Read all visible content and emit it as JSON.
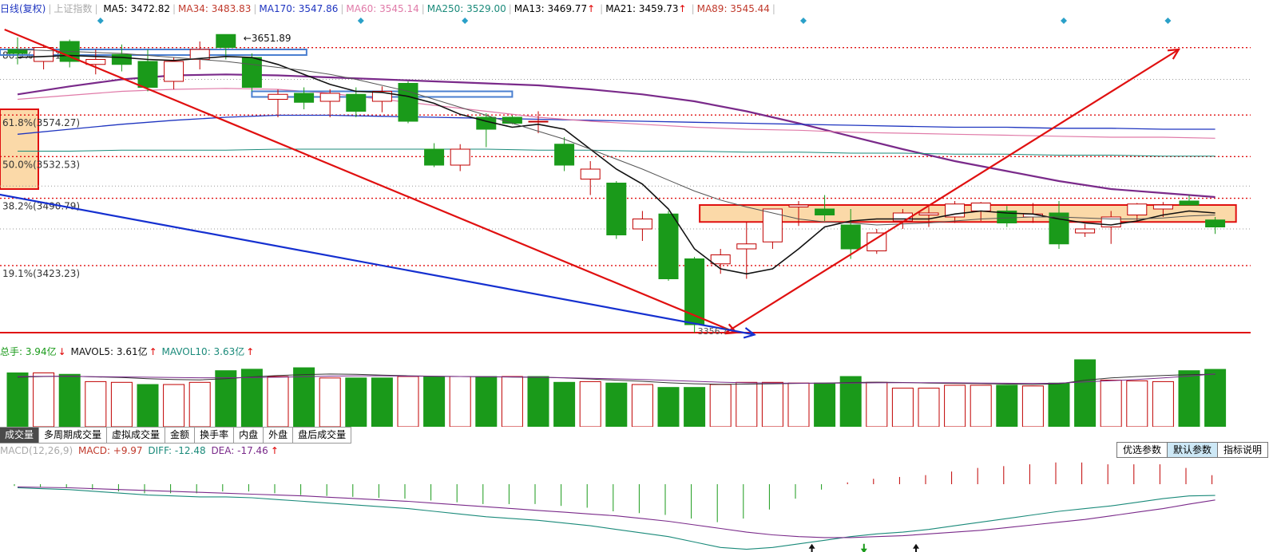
{
  "main_legend": {
    "title": "日线(复权)",
    "index_name": "上证指数",
    "ma_items": [
      {
        "label": "MA5: 3472.82",
        "color": "#000000",
        "arrow": false
      },
      {
        "label": "MA34: 3483.83",
        "color": "#c0392b",
        "arrow": false
      },
      {
        "label": "MA170: 3547.86",
        "color": "#1f35c0",
        "arrow": false
      },
      {
        "label": "MA60: 3545.14",
        "color": "#e07aa8",
        "arrow": false
      },
      {
        "label": "MA250: 3529.00",
        "color": "#1a8a7a",
        "arrow": false
      },
      {
        "label": "MA13: 3469.77",
        "color": "#000000",
        "arrow": true
      },
      {
        "label": "MA21: 3459.73",
        "color": "#000000",
        "arrow": true
      },
      {
        "label": "MA89: 3545.44",
        "color": "#c0392b",
        "arrow": false
      }
    ]
  },
  "fib_labels": [
    {
      "label": "80.9%(3641.82)",
      "price": 3641.82
    },
    {
      "label": "61.8%(3574.27)",
      "price": 3574.27
    },
    {
      "label": "50.0%(3532.53)",
      "price": 3532.53
    },
    {
      "label": "38.2%(3490.79)",
      "price": 3490.79
    },
    {
      "label": "19.1%(3423.23)",
      "price": 3423.23
    }
  ],
  "annotations": {
    "high_label": "3651.89",
    "low_label": "3356.?"
  },
  "volume_legend": {
    "total_label": "总手: 3.94亿",
    "mavol5_label": "MAVOL5: 3.61亿",
    "mavol10_label": "MAVOL10: 3.63亿"
  },
  "volume_tabs": [
    "成交量",
    "多周期成交量",
    "虚拟成交量",
    "金额",
    "换手率",
    "内盘",
    "外盘",
    "盘后成交量"
  ],
  "macd_legend": {
    "name_label": "MACD(12,26,9)",
    "macd_label": "MACD: +9.97",
    "diff_label": "DIFF: -12.48",
    "dea_label": "DEA: -17.46"
  },
  "macd_buttons": [
    "优选参数",
    "默认参数",
    "指标说明"
  ],
  "colors": {
    "up": "#c00000",
    "down": "#1a9a1a",
    "trend_red": "#e01010",
    "trend_blue": "#1530d0",
    "ma_purple": "#7a2a8a",
    "fib_dot": "#e01010",
    "box_fill": "#fbd9a8"
  },
  "chart_data": [
    {
      "type": "candlestick",
      "title": "上证指数 日线(复权)",
      "ylim": [
        3348,
        3672
      ],
      "horizontal_levels": [
        3641.82,
        3574.27,
        3532.53,
        3490.79,
        3423.23,
        3356.0
      ],
      "candles": [
        {
          "o": 3640,
          "h": 3652,
          "l": 3625,
          "c": 3636
        },
        {
          "o": 3628,
          "h": 3645,
          "l": 3620,
          "c": 3642
        },
        {
          "o": 3648,
          "h": 3650,
          "l": 3622,
          "c": 3628
        },
        {
          "o": 3625,
          "h": 3640,
          "l": 3615,
          "c": 3630
        },
        {
          "o": 3635,
          "h": 3645,
          "l": 3618,
          "c": 3625
        },
        {
          "o": 3628,
          "h": 3640,
          "l": 3598,
          "c": 3602
        },
        {
          "o": 3608,
          "h": 3632,
          "l": 3600,
          "c": 3628
        },
        {
          "o": 3630,
          "h": 3648,
          "l": 3620,
          "c": 3640
        },
        {
          "o": 3655,
          "h": 3652,
          "l": 3630,
          "c": 3642
        },
        {
          "o": 3632,
          "h": 3636,
          "l": 3598,
          "c": 3602
        },
        {
          "o": 3590,
          "h": 3600,
          "l": 3572,
          "c": 3595
        },
        {
          "o": 3596,
          "h": 3602,
          "l": 3580,
          "c": 3587
        },
        {
          "o": 3588,
          "h": 3600,
          "l": 3572,
          "c": 3596
        },
        {
          "o": 3595,
          "h": 3602,
          "l": 3572,
          "c": 3578
        },
        {
          "o": 3588,
          "h": 3603,
          "l": 3577,
          "c": 3598
        },
        {
          "o": 3606,
          "h": 3608,
          "l": 3566,
          "c": 3568
        },
        {
          "o": 3540,
          "h": 3546,
          "l": 3522,
          "c": 3524
        },
        {
          "o": 3524,
          "h": 3545,
          "l": 3518,
          "c": 3540
        },
        {
          "o": 3572,
          "h": 3576,
          "l": 3542,
          "c": 3560
        },
        {
          "o": 3572,
          "h": 3574,
          "l": 3565,
          "c": 3566
        },
        {
          "o": 3568,
          "h": 3578,
          "l": 3556,
          "c": 3568
        },
        {
          "o": 3545,
          "h": 3552,
          "l": 3518,
          "c": 3524
        },
        {
          "o": 3510,
          "h": 3528,
          "l": 3494,
          "c": 3520
        },
        {
          "o": 3506,
          "h": 3508,
          "l": 3450,
          "c": 3454
        },
        {
          "o": 3460,
          "h": 3478,
          "l": 3448,
          "c": 3470
        },
        {
          "o": 3475,
          "h": 3478,
          "l": 3408,
          "c": 3410
        },
        {
          "o": 3430,
          "h": 3432,
          "l": 3356,
          "c": 3364
        },
        {
          "o": 3425,
          "h": 3440,
          "l": 3415,
          "c": 3434
        },
        {
          "o": 3440,
          "h": 3467,
          "l": 3410,
          "c": 3445
        },
        {
          "o": 3447,
          "h": 3477,
          "l": 3440,
          "c": 3480
        },
        {
          "o": 3482,
          "h": 3488,
          "l": 3463,
          "c": 3484
        },
        {
          "o": 3480,
          "h": 3494,
          "l": 3468,
          "c": 3474
        },
        {
          "o": 3464,
          "h": 3480,
          "l": 3430,
          "c": 3440
        },
        {
          "o": 3438,
          "h": 3460,
          "l": 3435,
          "c": 3456
        },
        {
          "o": 3468,
          "h": 3480,
          "l": 3460,
          "c": 3476
        },
        {
          "o": 3474,
          "h": 3482,
          "l": 3462,
          "c": 3476
        },
        {
          "o": 3472,
          "h": 3488,
          "l": 3466,
          "c": 3485
        },
        {
          "o": 3478,
          "h": 3487,
          "l": 3468,
          "c": 3486
        },
        {
          "o": 3478,
          "h": 3483,
          "l": 3462,
          "c": 3466
        },
        {
          "o": 3472,
          "h": 3486,
          "l": 3466,
          "c": 3475
        },
        {
          "o": 3476,
          "h": 3488,
          "l": 3440,
          "c": 3445
        },
        {
          "o": 3456,
          "h": 3465,
          "l": 3452,
          "c": 3460
        },
        {
          "o": 3462,
          "h": 3478,
          "l": 3445,
          "c": 3472
        },
        {
          "o": 3474,
          "h": 3486,
          "l": 3468,
          "c": 3485
        },
        {
          "o": 3480,
          "h": 3487,
          "l": 3472,
          "c": 3484
        },
        {
          "o": 3488,
          "h": 3494,
          "l": 3484,
          "c": 3484
        },
        {
          "o": 3469,
          "h": 3472,
          "l": 3455,
          "c": 3462
        }
      ],
      "ma_lines": [
        {
          "name": "MA5",
          "color": "#111111",
          "values": [
            3632,
            3633,
            3634,
            3633,
            3632,
            3630,
            3629,
            3631,
            3633,
            3632,
            3625,
            3615,
            3605,
            3598,
            3597,
            3593,
            3586,
            3575,
            3568,
            3562,
            3565,
            3560,
            3540,
            3520,
            3505,
            3480,
            3440,
            3420,
            3415,
            3420,
            3440,
            3462,
            3468,
            3470,
            3470,
            3470,
            3475,
            3478,
            3476,
            3475,
            3470,
            3466,
            3464,
            3468,
            3474,
            3478,
            3476
          ]
        },
        {
          "name": "MA13",
          "color": "#555555",
          "values": [
            3640,
            3639,
            3638,
            3637,
            3636,
            3634,
            3632,
            3630,
            3628,
            3625,
            3622,
            3619,
            3615,
            3610,
            3604,
            3598,
            3590,
            3582,
            3574,
            3566,
            3558,
            3550,
            3540,
            3530,
            3520,
            3509,
            3498,
            3489,
            3482,
            3476,
            3470,
            3467,
            3466,
            3464,
            3465,
            3466,
            3468,
            3470,
            3471,
            3472,
            3472,
            3471,
            3470,
            3470,
            3471,
            3473,
            3474
          ]
        }
      ],
      "trendlines": [
        {
          "from": [
            -0.5,
            3660
          ],
          "to": [
            27.6,
            3356
          ],
          "color": "#e01010"
        },
        {
          "from": [
            27.2,
            3356
          ],
          "to": [
            44.6,
            3640
          ],
          "color": "#e01010"
        },
        {
          "from": [
            -1.0,
            3496
          ],
          "to": [
            28.3,
            3354
          ],
          "color": "#1530d0"
        }
      ]
    },
    {
      "type": "bar",
      "title": "成交量",
      "ylim": [
        0,
        4.6
      ],
      "values": [
        3.7,
        3.7,
        3.6,
        3.1,
        3.05,
        2.9,
        2.9,
        3.05,
        3.85,
        3.95,
        3.45,
        4.05,
        3.35,
        3.35,
        3.35,
        3.45,
        3.45,
        3.45,
        3.45,
        3.45,
        3.45,
        3.05,
        3.1,
        3.0,
        2.9,
        2.7,
        2.7,
        2.9,
        3.05,
        3.05,
        3.0,
        3.0,
        3.45,
        3.05,
        2.65,
        2.65,
        2.85,
        2.85,
        2.85,
        2.8,
        3.0,
        4.6,
        3.2,
        3.15,
        3.1,
        3.85,
        3.94
      ],
      "up": [
        false,
        true,
        false,
        true,
        true,
        false,
        true,
        true,
        false,
        false,
        true,
        false,
        true,
        false,
        false,
        true,
        false,
        true,
        false,
        true,
        false,
        false,
        true,
        false,
        true,
        false,
        false,
        true,
        true,
        true,
        true,
        false,
        false,
        true,
        true,
        true,
        true,
        true,
        false,
        true,
        false,
        false,
        true,
        true,
        true,
        false,
        false
      ],
      "ma_lines": [
        {
          "name": "MAVOL5",
          "values": [
            3.4,
            3.45,
            3.48,
            3.42,
            3.38,
            3.3,
            3.25,
            3.22,
            3.3,
            3.42,
            3.52,
            3.58,
            3.62,
            3.6,
            3.55,
            3.5,
            3.47,
            3.45,
            3.43,
            3.41,
            3.4,
            3.35,
            3.28,
            3.2,
            3.12,
            3.02,
            2.95,
            2.92,
            2.93,
            2.95,
            2.98,
            3.0,
            3.04,
            3.06,
            3.04,
            3.0,
            2.98,
            2.96,
            2.93,
            2.9,
            2.95,
            3.2,
            3.35,
            3.45,
            3.52,
            3.58,
            3.61
          ]
        },
        {
          "name": "MAVOL10",
          "values": [
            3.45,
            3.46,
            3.46,
            3.44,
            3.42,
            3.4,
            3.38,
            3.36,
            3.36,
            3.38,
            3.4,
            3.44,
            3.48,
            3.5,
            3.5,
            3.48,
            3.46,
            3.45,
            3.44,
            3.42,
            3.4,
            3.37,
            3.33,
            3.29,
            3.24,
            3.18,
            3.12,
            3.06,
            3.02,
            3.0,
            2.99,
            2.99,
            3.0,
            3.02,
            3.03,
            3.03,
            3.02,
            3.0,
            2.99,
            2.98,
            2.99,
            3.08,
            3.16,
            3.25,
            3.35,
            3.48,
            3.63
          ]
        }
      ]
    },
    {
      "type": "line",
      "title": "MACD(12,26,9)",
      "ylim": [
        -75,
        30
      ],
      "diff": [
        -4,
        -5,
        -6,
        -8,
        -10,
        -12,
        -13,
        -14,
        -14,
        -15,
        -17,
        -19,
        -21,
        -23,
        -25,
        -27,
        -30,
        -33,
        -36,
        -38,
        -40,
        -43,
        -46,
        -50,
        -54,
        -58,
        -64,
        -70,
        -72,
        -70,
        -66,
        -62,
        -58,
        -55,
        -53,
        -50,
        -46,
        -42,
        -38,
        -34,
        -30,
        -27,
        -24,
        -20,
        -16,
        -13,
        -12.48
      ],
      "dea": [
        -3,
        -3.5,
        -4,
        -5,
        -6,
        -7,
        -8,
        -9,
        -10,
        -11,
        -12,
        -13,
        -14.5,
        -16,
        -17.5,
        -19,
        -21,
        -23,
        -25,
        -27,
        -29,
        -31,
        -33,
        -35,
        -38,
        -41,
        -45,
        -49,
        -53,
        -56,
        -58,
        -59,
        -59,
        -58,
        -57,
        -55,
        -53,
        -51,
        -48,
        -45,
        -42,
        -39,
        -35,
        -31,
        -27,
        -22,
        -17.46
      ],
      "macd": [
        -2,
        -3,
        -4,
        -6,
        -8,
        -10,
        -10,
        -10,
        -8,
        -8,
        -10,
        -12,
        -13,
        -14,
        -15,
        -16,
        -18,
        -20,
        -22,
        -22,
        -22,
        -24,
        -26,
        -30,
        -32,
        -34,
        -38,
        -42,
        -38,
        -28,
        -16,
        -6,
        2,
        6,
        8,
        10,
        14,
        18,
        20,
        22,
        24,
        24,
        22,
        22,
        22,
        18,
        9.97
      ]
    }
  ]
}
